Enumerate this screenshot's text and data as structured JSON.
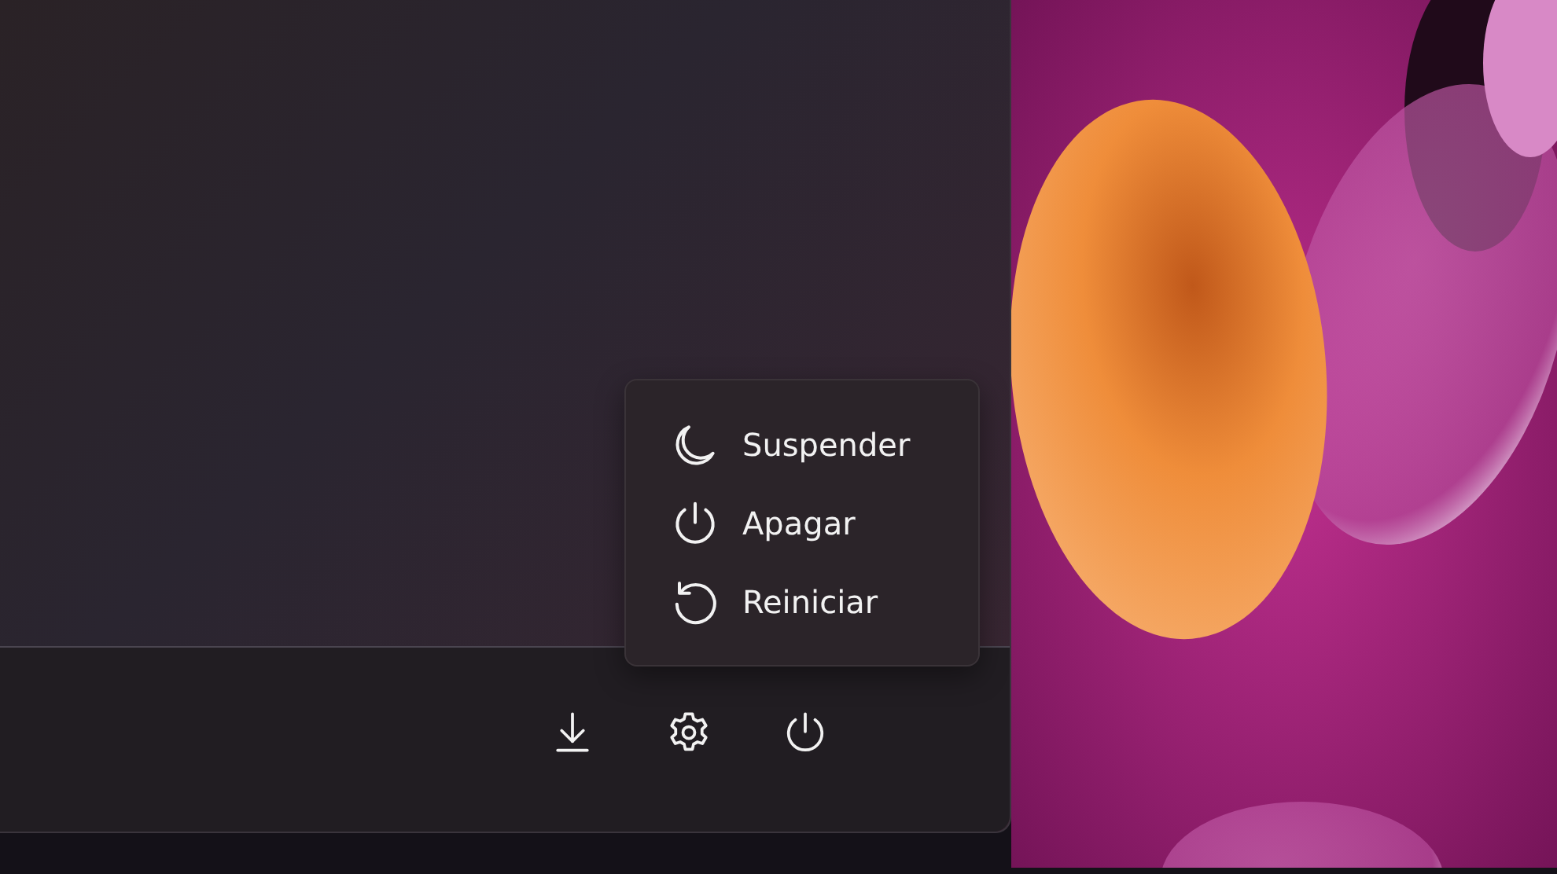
{
  "power_menu": {
    "items": [
      {
        "kind": "sleep",
        "label": "Suspender"
      },
      {
        "kind": "shutdown",
        "label": "Apagar"
      },
      {
        "kind": "restart",
        "label": "Reiniciar"
      }
    ]
  },
  "footer_buttons": [
    {
      "kind": "download"
    },
    {
      "kind": "settings"
    },
    {
      "kind": "power"
    }
  ]
}
